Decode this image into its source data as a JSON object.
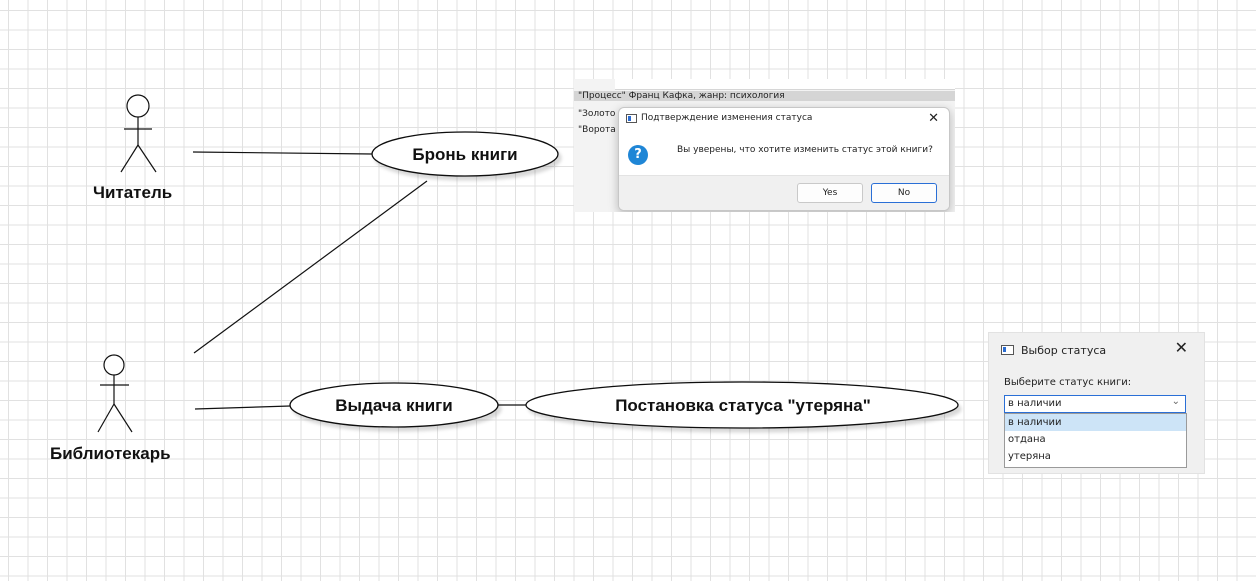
{
  "actors": [
    {
      "label": "Читатель"
    },
    {
      "label": "Библиотекарь"
    }
  ],
  "use_cases": [
    {
      "label": "Бронь книги"
    },
    {
      "label": "Выдача книги"
    },
    {
      "label": "Постановка статуса \"утеряна\""
    }
  ],
  "confirm_screenshot": {
    "list_rows": [
      "\"Процесс\" Франц Кафка, жанр: психология",
      "\"Золото",
      "\"Ворота"
    ],
    "dialog_title": "Подтверждение изменения статуса",
    "message": "Вы уверены, что хотите изменить статус этой книги?",
    "yes_label": "Yes",
    "no_label": "No",
    "question_icon": "question-icon",
    "close_glyph": "✕"
  },
  "status_screenshot": {
    "title": "Выбор статуса",
    "prompt": "Выберите статус книги:",
    "selected": "в наличии",
    "options": [
      "в наличии",
      "отдана",
      "утеряна"
    ],
    "close_glyph": "✕"
  },
  "colors": {
    "grid": "#e1e1e1",
    "accent": "#2a6fd6",
    "selection": "#cde4f7"
  }
}
